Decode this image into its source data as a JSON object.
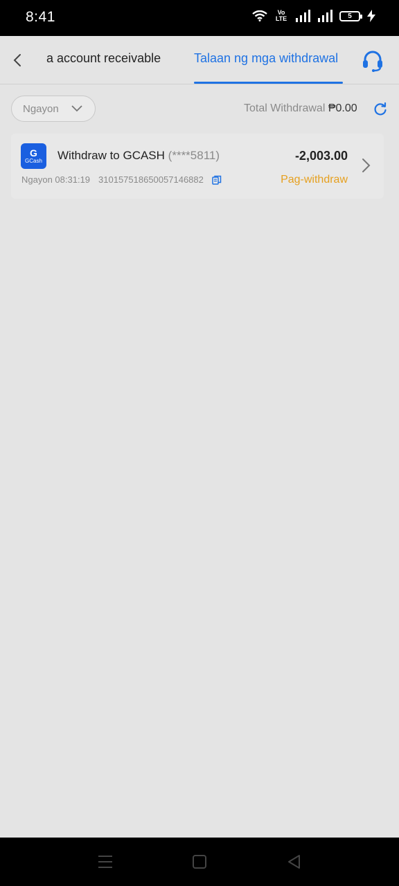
{
  "status_bar": {
    "time": "8:41",
    "battery_level": "5",
    "network_label": "Vo LTE"
  },
  "header": {
    "tabs": [
      {
        "label": "a account receivable",
        "active": false
      },
      {
        "label": "Talaan ng mga withdrawal",
        "active": true
      }
    ],
    "accent_color": "#1f72e3"
  },
  "filter": {
    "date_value": "Ngayon",
    "total_label": "Total Withdrawal",
    "total_amount": "₱0.00"
  },
  "transactions": [
    {
      "title": "Withdraw to GCASH",
      "account_mask": "(****5811)",
      "amount": "-2,003.00",
      "date_time": "Ngayon 08:31:19",
      "reference": "310157518650057146882",
      "status": "Pag-withdraw",
      "status_color": "#e6a01f",
      "logo": {
        "letter": "G",
        "word": "GCash"
      }
    }
  ],
  "icons": {
    "back": "chevron-left-icon",
    "support": "headset-icon",
    "refresh": "refresh-icon",
    "copy": "copy-icon",
    "row": "chevron-right-icon",
    "nav": [
      "menu-icon",
      "home-square-icon",
      "back-triangle-icon"
    ]
  }
}
